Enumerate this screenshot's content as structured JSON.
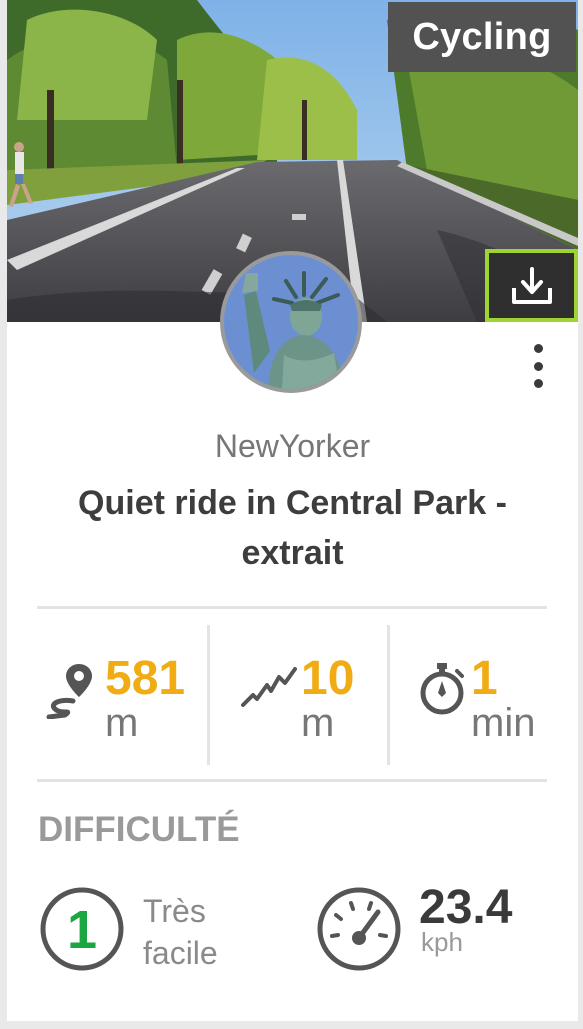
{
  "route": {
    "sport": "Cycling",
    "author": "NewYorker",
    "title": "Quiet ride in Central Park - extrait"
  },
  "actions": {
    "download_icon": "download-icon",
    "more_icon": "more-vertical-icon"
  },
  "stats": [
    {
      "icon": "route-distance-icon",
      "value": "581",
      "unit": "m"
    },
    {
      "icon": "elevation-icon",
      "value": "10",
      "unit": "m"
    },
    {
      "icon": "stopwatch-icon",
      "value": "1",
      "unit": "min"
    }
  ],
  "difficulty": {
    "heading": "DIFFICULTÉ",
    "level_number": "1",
    "level_label": "Très facile",
    "speed_value": "23.4",
    "speed_unit": "kph"
  },
  "colors": {
    "accent_yellow": "#f0ac12",
    "highlight_green": "#9fd233",
    "level_green": "#1aa640",
    "badge_gray": "#525252"
  }
}
